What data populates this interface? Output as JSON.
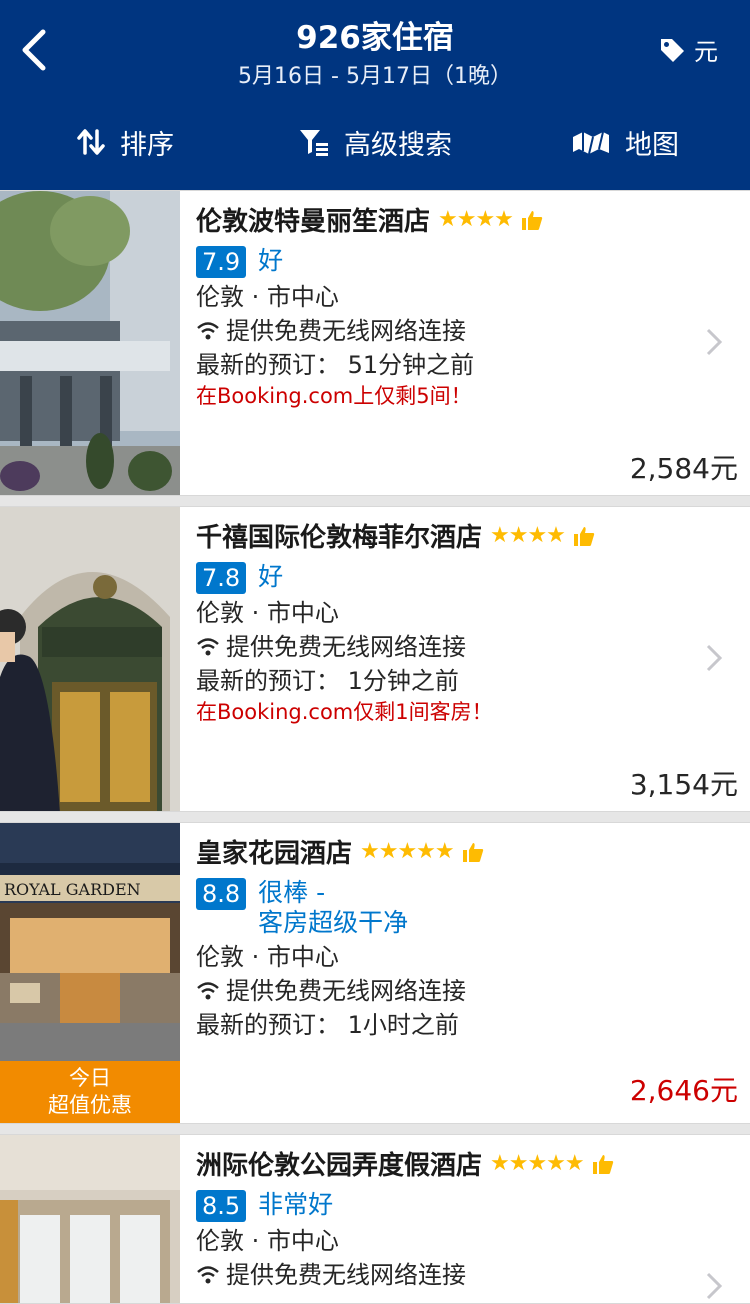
{
  "header": {
    "title": "926家住宿",
    "dates": "5月16日 - 5月17日（1晚）",
    "currency": "元"
  },
  "toolbar": {
    "sort": "排序",
    "filter": "高级搜索",
    "map": "地图"
  },
  "colors": {
    "brand": "#003580",
    "score": "#0077cc",
    "star": "#febb02",
    "urgent": "#cc0000",
    "deal": "#f28b00"
  },
  "hotels": [
    {
      "name": "伦敦波特曼丽笙酒店",
      "stars": "★★★★",
      "score": "7.9",
      "score_label": "好",
      "location": "伦敦 · 市中心",
      "wifi": "提供免费无线网络连接",
      "last_booked": "最新的预订：  51分钟之前",
      "urgency": "在Booking.com上仅剩5间！",
      "price": "2,584元"
    },
    {
      "name": "千禧国际伦敦梅菲尔酒店",
      "stars": "★★★★",
      "score": "7.8",
      "score_label": "好",
      "location": "伦敦 · 市中心",
      "wifi": "提供免费无线网络连接",
      "last_booked": "最新的预订：  1分钟之前",
      "urgency": "在Booking.com仅剩1间客房！",
      "price": "3,154元"
    },
    {
      "name": "皇家花园酒店",
      "stars": "★★★★★",
      "score": "8.8",
      "score_label": "很棒 -",
      "score_label2": "客房超级干净",
      "location": "伦敦 · 市中心",
      "wifi": "提供免费无线网络连接",
      "last_booked": "最新的预订：  1小时之前",
      "deal_line1": "今日",
      "deal_line2": "超值优惠",
      "photo_sign": "ROYAL GARDEN",
      "price": "2,646元"
    },
    {
      "name": "洲际伦敦公园弄度假酒店",
      "stars": "★★★★★",
      "score": "8.5",
      "score_label": "非常好",
      "location": "伦敦 · 市中心",
      "wifi": "提供免费无线网络连接"
    }
  ]
}
